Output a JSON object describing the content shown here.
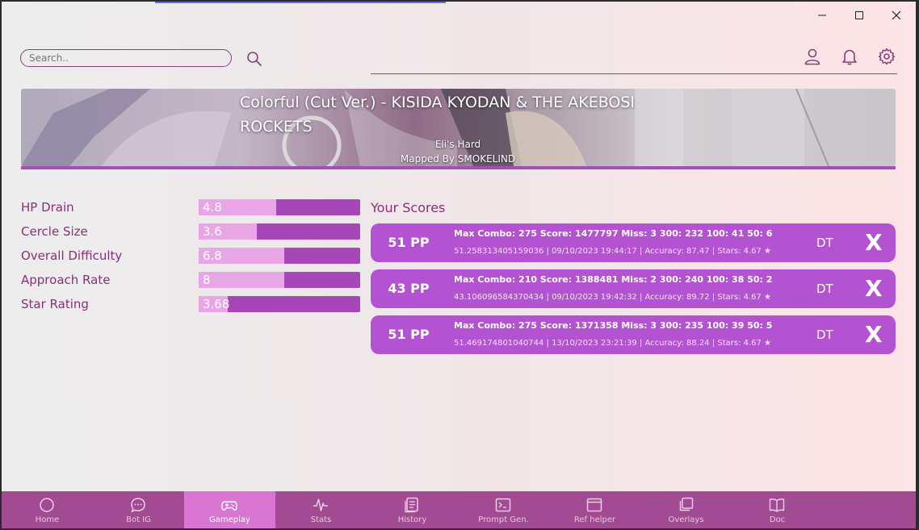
{
  "search": {
    "placeholder": "Search.."
  },
  "beatmap": {
    "title": "Colorful (Cut Ver.) - KISIDA KYODAN & THE AKEBOSI ROCKETS",
    "difficulty": "Eli's Hard",
    "mapper": "Mapped By SMOKELIND"
  },
  "stats": [
    {
      "label": "HP Drain",
      "value": "4.8",
      "fill": 0.48
    },
    {
      "label": "Cercle Size",
      "value": "3.6",
      "fill": 0.36
    },
    {
      "label": "Overall Difficulty",
      "value": "6.8",
      "fill": 0.53
    },
    {
      "label": "Approach Rate",
      "value": "8",
      "fill": 0.53
    },
    {
      "label": "Star Rating",
      "value": "3.68",
      "fill": 0.18
    }
  ],
  "scores_title": "Your Scores",
  "scores": [
    {
      "pp": "51 PP",
      "main": "Max Combo: 275 Score: 1477797 Miss: 3 300: 232 100: 41 50: 6",
      "sub": "51.258313405159036 | 09/10/2023 19:44:17 | Accuracy: 87.47 | Stars: 4.67 ★",
      "mods": "DT",
      "delete": "X"
    },
    {
      "pp": "43 PP",
      "main": "Max Combo: 210 Score: 1388481 Miss: 2 300: 240 100: 38 50: 2",
      "sub": "43.106096584370434 | 09/10/2023 19:42:32 | Accuracy: 89.72 | Stars: 4.67 ★",
      "mods": "DT",
      "delete": "X"
    },
    {
      "pp": "51 PP",
      "main": "Max Combo: 275 Score: 1371358 Miss: 3 300: 235 100: 39 50: 5",
      "sub": "51.469174801040744 | 13/10/2023 23:21:39 | Accuracy: 88.24 | Stars: 4.67 ★",
      "mods": "DT",
      "delete": "X"
    }
  ],
  "nav": [
    {
      "label": "Home",
      "icon": "circle-icon"
    },
    {
      "label": "Bot IG",
      "icon": "chat-icon"
    },
    {
      "label": "Gameplay",
      "icon": "gamepad-icon",
      "active": true
    },
    {
      "label": "Stats",
      "icon": "pulse-icon"
    },
    {
      "label": "History",
      "icon": "history-icon"
    },
    {
      "label": "Prompt Gen.",
      "icon": "terminal-icon"
    },
    {
      "label": "Ref helper",
      "icon": "window-icon"
    },
    {
      "label": "Overlays",
      "icon": "overlays-icon"
    },
    {
      "label": "Doc",
      "icon": "book-icon"
    }
  ],
  "colors": {
    "accent": "#a24a92",
    "bar": "#a646b8",
    "bar_fill": "#e9a6e6",
    "card": "#b453d2",
    "text_accent": "#8b2f78"
  }
}
